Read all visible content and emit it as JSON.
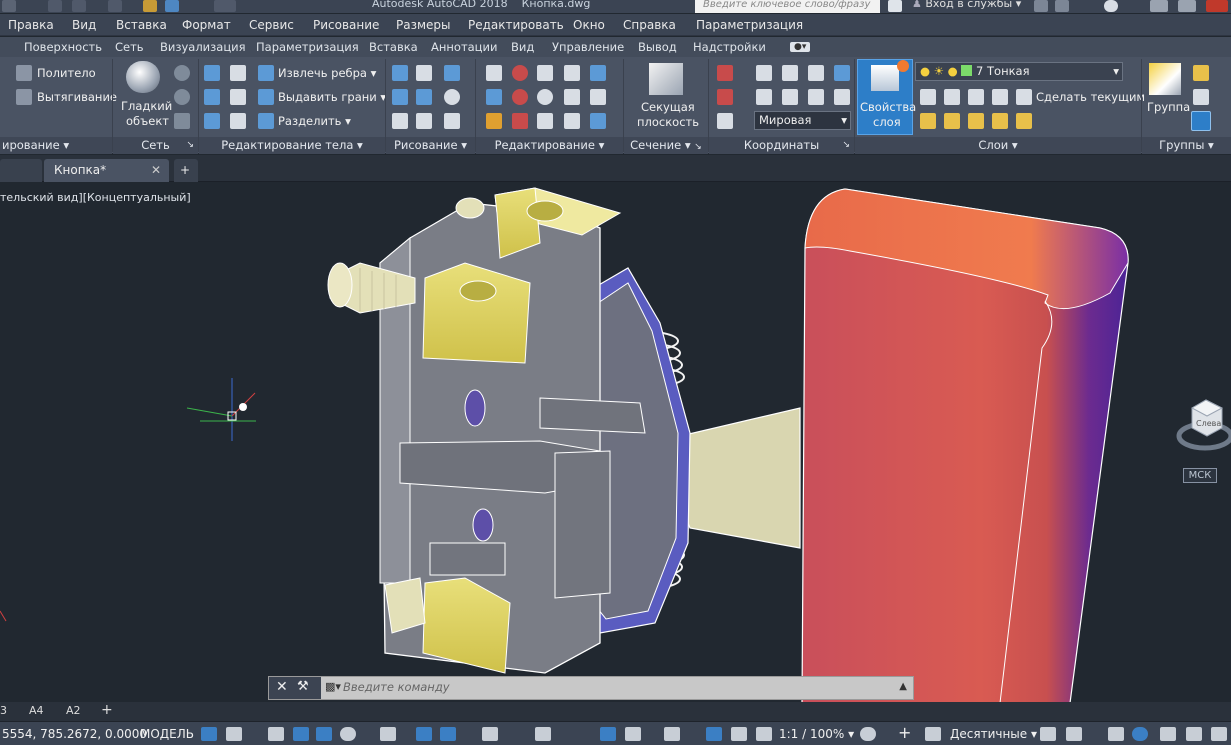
{
  "titlebar": {
    "app_title": "Autodesk AutoCAD 2018",
    "file_title": "Кнопка.dwg",
    "search_placeholder": "Введите ключевое слово/фразу",
    "login": "Вход в службы"
  },
  "menu": [
    "Правка",
    "Вид",
    "Вставка",
    "Формат",
    "Сервис",
    "Рисование",
    "Размеры",
    "Редактировать",
    "Окно",
    "Справка",
    "Параметризация"
  ],
  "ribbon_tabs": [
    "Поверхность",
    "Сеть",
    "Визуализация",
    "Параметризация",
    "Вставка",
    "Аннотации",
    "Вид",
    "Управление",
    "Вывод",
    "Надстройки"
  ],
  "ribbon": {
    "polysolid": "Политело",
    "extrude": "Вытягивание",
    "smooth_object_1": "Гладкий",
    "smooth_object_2": "объект",
    "extract_edges": "Извлечь ребра",
    "extrude_faces": "Выдавить грани",
    "separate": "Разделить",
    "section_plane_1": "Секущая",
    "section_plane_2": "плоскость",
    "layer_props_1": "Свойства",
    "layer_props_2": "слоя",
    "layer_current": "7 Тонкая",
    "make_current": "Сделать текущим",
    "world": "Мировая",
    "group": "Группа",
    "panels": {
      "modeling": "ирование",
      "mesh": "Сеть",
      "solid_edit": "Редактирование тела",
      "draw": "Рисование",
      "modify": "Редактирование",
      "section": "Сечение",
      "coordinates": "Координаты",
      "layers": "Слои",
      "groups": "Группы"
    }
  },
  "file_tabs": {
    "active": "Кнопка*"
  },
  "viewport": {
    "label": "тельский вид][Концептуальный]"
  },
  "viewcube": {
    "face": "Слева",
    "ucs": "МСК"
  },
  "command": {
    "placeholder": "Введите команду"
  },
  "layout_tabs": [
    "3",
    "A4",
    "A2"
  ],
  "status": {
    "coords": "5554, 785.2672, 0.0000",
    "model": "МОДЕЛЬ",
    "scale": "1:1 / 100%",
    "units": "Десятичные"
  },
  "colors": {
    "accent": "#2d7ec8",
    "background": "#212830",
    "ribbon": "#4a5363"
  }
}
